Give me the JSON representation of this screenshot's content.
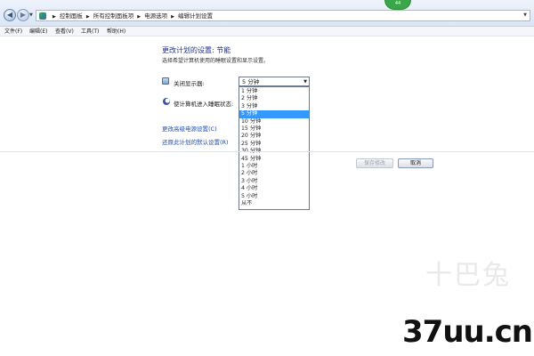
{
  "window": {
    "nav_back_icon": "back-arrow-icon",
    "nav_forward_icon": "forward-arrow-icon",
    "breadcrumbs": [
      "控制面板",
      "所有控制面板项",
      "电源选项",
      "编辑计划设置"
    ],
    "badge": "44"
  },
  "menu": {
    "items": [
      "文件(F)",
      "编辑(E)",
      "查看(V)",
      "工具(T)",
      "帮助(H)"
    ]
  },
  "page": {
    "title": "更改计划的设置: 节能",
    "subtitle": "选择希望计算机使用的睡眠设置和显示设置。",
    "display_label": "关闭显示器:",
    "sleep_label": "使计算机进入睡眠状态:",
    "display_selected": "5 分钟",
    "link_advanced": "更改高级电源设置(C)",
    "link_restore": "还原此计划的默认设置(R)",
    "save_button": "保存修改",
    "cancel_button": "取消"
  },
  "dropdown": {
    "options": [
      "1 分钟",
      "2 分钟",
      "3 分钟",
      "5 分钟",
      "10 分钟",
      "15 分钟",
      "20 分钟",
      "25 分钟",
      "30 分钟",
      "45 分钟",
      "1 小时",
      "2 小时",
      "3 小时",
      "4 小时",
      "5 小时",
      "从不"
    ],
    "highlighted": "5 分钟",
    "highlight_color": "#3399ff"
  },
  "watermark": {
    "brand_cn": "十巴兔",
    "url": "37uu.cn"
  }
}
